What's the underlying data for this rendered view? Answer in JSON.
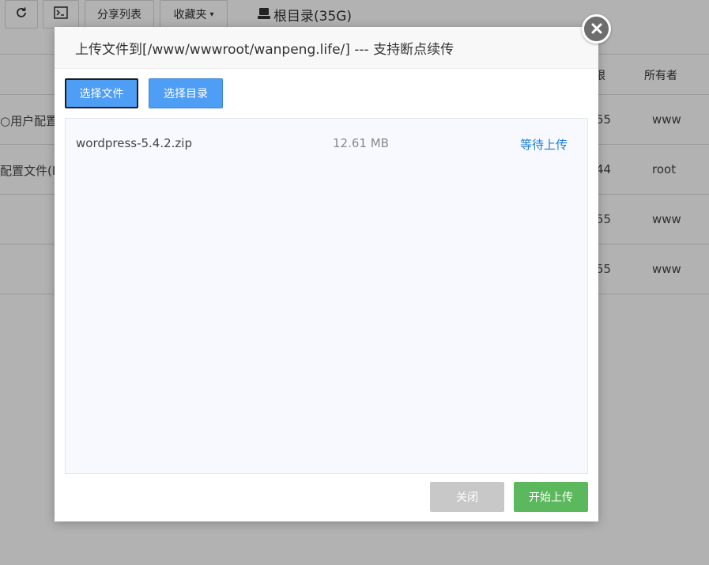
{
  "background": {
    "toolbar": {
      "share_label": "分享列表",
      "fav_label": "收藏夹",
      "root_label": "根目录(35G)"
    },
    "table": {
      "headers": {
        "permission": "限",
        "owner": "所有者"
      },
      "rows": [
        {
          "name": "○用户配置文",
          "permission": "55",
          "owner": "www"
        },
        {
          "name": "配置文件(I",
          "permission": "44",
          "owner": "root"
        },
        {
          "name": "",
          "permission": "55",
          "owner": "www"
        },
        {
          "name": "",
          "permission": "55",
          "owner": "www"
        }
      ]
    }
  },
  "dialog": {
    "title": "上传文件到[/www/wwwroot/wanpeng.life/] --- 支持断点续传",
    "select_file_label": "选择文件",
    "select_dir_label": "选择目录",
    "files": [
      {
        "name": "wordpress-5.4.2.zip",
        "size": "12.61 MB",
        "status": "等待上传"
      }
    ],
    "close_label": "关闭",
    "start_label": "开始上传"
  },
  "icons": {
    "refresh": "refresh-icon",
    "terminal": "terminal-icon",
    "disk": "disk-icon",
    "close": "close-icon",
    "caret": "caret-down-icon"
  }
}
